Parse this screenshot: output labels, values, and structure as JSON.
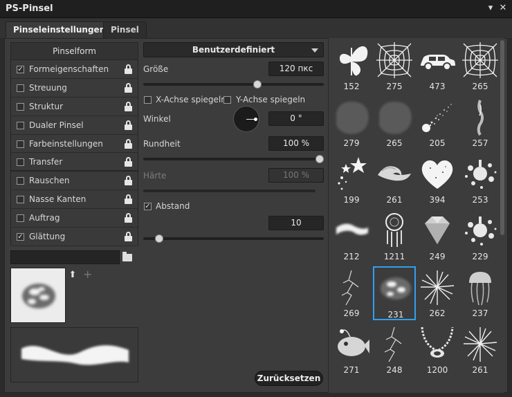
{
  "window": {
    "title": "PS-Pinsel"
  },
  "tabs": [
    {
      "label": "Pinseleinstellungen",
      "active": true
    },
    {
      "label": "Pinsel",
      "active": false
    }
  ],
  "sidebar": {
    "header": "Pinselform",
    "items": [
      {
        "label": "Formeigenschaften",
        "checked": true
      },
      {
        "label": "Streuung",
        "checked": false
      },
      {
        "label": "Struktur",
        "checked": false
      },
      {
        "label": "Dualer Pinsel",
        "checked": false
      },
      {
        "label": "Farbeinstellungen",
        "checked": false
      },
      {
        "label": "Transfer",
        "checked": false
      },
      {
        "label": "Rauschen",
        "checked": false
      },
      {
        "label": "Nasse Kanten",
        "checked": false
      },
      {
        "label": "Auftrag",
        "checked": false
      },
      {
        "label": "Glättung",
        "checked": true
      }
    ],
    "name_value": ""
  },
  "settings": {
    "preset": "Benutzerdefiniert",
    "size_label": "Größe",
    "size_value": "120 пкс",
    "size_slider": 0.64,
    "flip_x_label": "X-Achse spiegeln",
    "flip_y_label": "Y-Achse spiegeln",
    "flip_x": false,
    "flip_y": false,
    "angle_label": "Winkel",
    "angle_value": "0 °",
    "roundness_label": "Rundheit",
    "roundness_value": "100 %",
    "roundness_slider": 1.0,
    "hardness_label": "Härte",
    "hardness_value": "100 %",
    "hardness_slider": 1.0,
    "spacing_label": "Abstand",
    "spacing_checked": true,
    "spacing_value": "10",
    "spacing_slider": 0.07,
    "reset_label": "Zurücksetzen"
  },
  "brushes": [
    {
      "num": "152",
      "icon": "butterfly-icon"
    },
    {
      "num": "275",
      "icon": "spiderweb-icon"
    },
    {
      "num": "473",
      "icon": "car-icon"
    },
    {
      "num": "265",
      "icon": "spiderweb-icon"
    },
    {
      "num": "279",
      "icon": "watercolor-blob-icon"
    },
    {
      "num": "265",
      "icon": "watercolor-blob-icon"
    },
    {
      "num": "205",
      "icon": "comet-icon"
    },
    {
      "num": "257",
      "icon": "smoke-icon"
    },
    {
      "num": "199",
      "icon": "stars-icon"
    },
    {
      "num": "261",
      "icon": "wave-icon"
    },
    {
      "num": "394",
      "icon": "heart-icon"
    },
    {
      "num": "253",
      "icon": "splatter-icon"
    },
    {
      "num": "212",
      "icon": "cloud-stroke-icon"
    },
    {
      "num": "1211",
      "icon": "dreamcatcher-icon"
    },
    {
      "num": "249",
      "icon": "diamond-icon"
    },
    {
      "num": "229",
      "icon": "splatter-icon"
    },
    {
      "num": "269",
      "icon": "lightning-icon"
    },
    {
      "num": "231",
      "icon": "cloud-brush-icon",
      "selected": true
    },
    {
      "num": "262",
      "icon": "firework-icon"
    },
    {
      "num": "237",
      "icon": "jellyfish-icon"
    },
    {
      "num": "271",
      "icon": "anglerfish-icon"
    },
    {
      "num": "248",
      "icon": "lightning-icon"
    },
    {
      "num": "1200",
      "icon": "necklace-icon"
    },
    {
      "num": "261",
      "icon": "firework-icon"
    }
  ]
}
